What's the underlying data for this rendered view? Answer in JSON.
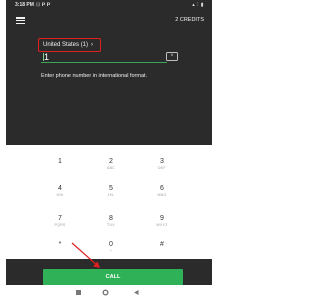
{
  "status_bar": {
    "time": "3:18 PM",
    "notifications": "⊡ 𝗣 𝗣",
    "right": "▴ ⫶ ▮"
  },
  "app_bar": {
    "menu_icon": "hamburger-menu-icon",
    "credits": "2 CREDITS"
  },
  "phone": {
    "country": "United States (1)",
    "input_value": "1",
    "clear_icon": "backspace-icon",
    "hint": "Enter phone number in international format."
  },
  "keypad": {
    "keys": [
      {
        "digit": "1",
        "letters": ""
      },
      {
        "digit": "2",
        "letters": "ABC"
      },
      {
        "digit": "3",
        "letters": "DEF"
      },
      {
        "digit": "4",
        "letters": "GHI"
      },
      {
        "digit": "5",
        "letters": "JKL"
      },
      {
        "digit": "6",
        "letters": "MNO"
      },
      {
        "digit": "7",
        "letters": "PQRS"
      },
      {
        "digit": "8",
        "letters": "TUV"
      },
      {
        "digit": "9",
        "letters": "WXYZ"
      },
      {
        "digit": "*",
        "letters": ""
      },
      {
        "digit": "0",
        "letters": "+"
      },
      {
        "digit": "#",
        "letters": ""
      }
    ]
  },
  "call_button": {
    "label": "CALL"
  },
  "nav_bar": {
    "recents_icon": "square-recents-icon",
    "home_icon": "circle-home-icon",
    "back_icon": "triangle-back-icon"
  },
  "annotation": {
    "highlight_color": "#e0201e",
    "arrow_color": "#e0201e"
  }
}
